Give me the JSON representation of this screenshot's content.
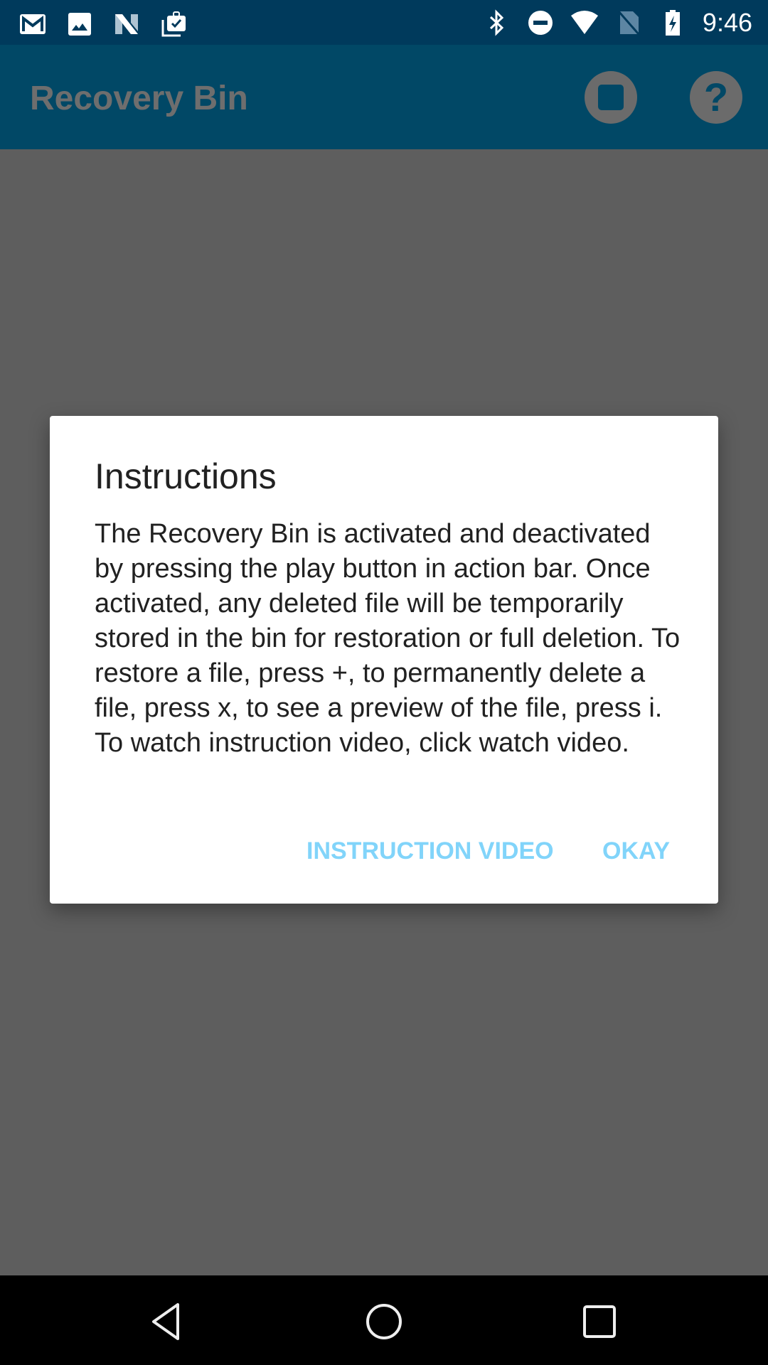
{
  "status_bar": {
    "time": "9:46",
    "left_icons": [
      "gmail-icon",
      "photos-icon",
      "n-app-icon",
      "tasks-icon"
    ],
    "right_icons": [
      "bluetooth-icon",
      "do-not-disturb-icon",
      "wifi-icon",
      "no-sim-icon",
      "battery-charging-icon"
    ]
  },
  "action_bar": {
    "title": "Recovery Bin",
    "actions": [
      "stop-icon",
      "help-icon"
    ],
    "help_glyph": "?"
  },
  "dialog": {
    "title": "Instructions",
    "message": "The Recovery Bin is activated and deactivated by pressing the play button in action bar. Once activated, any deleted file will be temporarily stored in the bin for restoration or full deletion. To restore a file, press +, to permanently delete a file, press x, to see a preview of the file, press i. To watch instruction video, click watch video.",
    "buttons": {
      "instruction_video": "INSTRUCTION VIDEO",
      "okay": "OKAY"
    },
    "accent_color": "#81d4fa"
  },
  "nav_bar": {
    "buttons": [
      "back-icon",
      "home-icon",
      "recents-icon"
    ]
  },
  "colors": {
    "status_bar": "#003a5c",
    "action_bar": "#014866",
    "scrim": "#5e5e5e"
  }
}
